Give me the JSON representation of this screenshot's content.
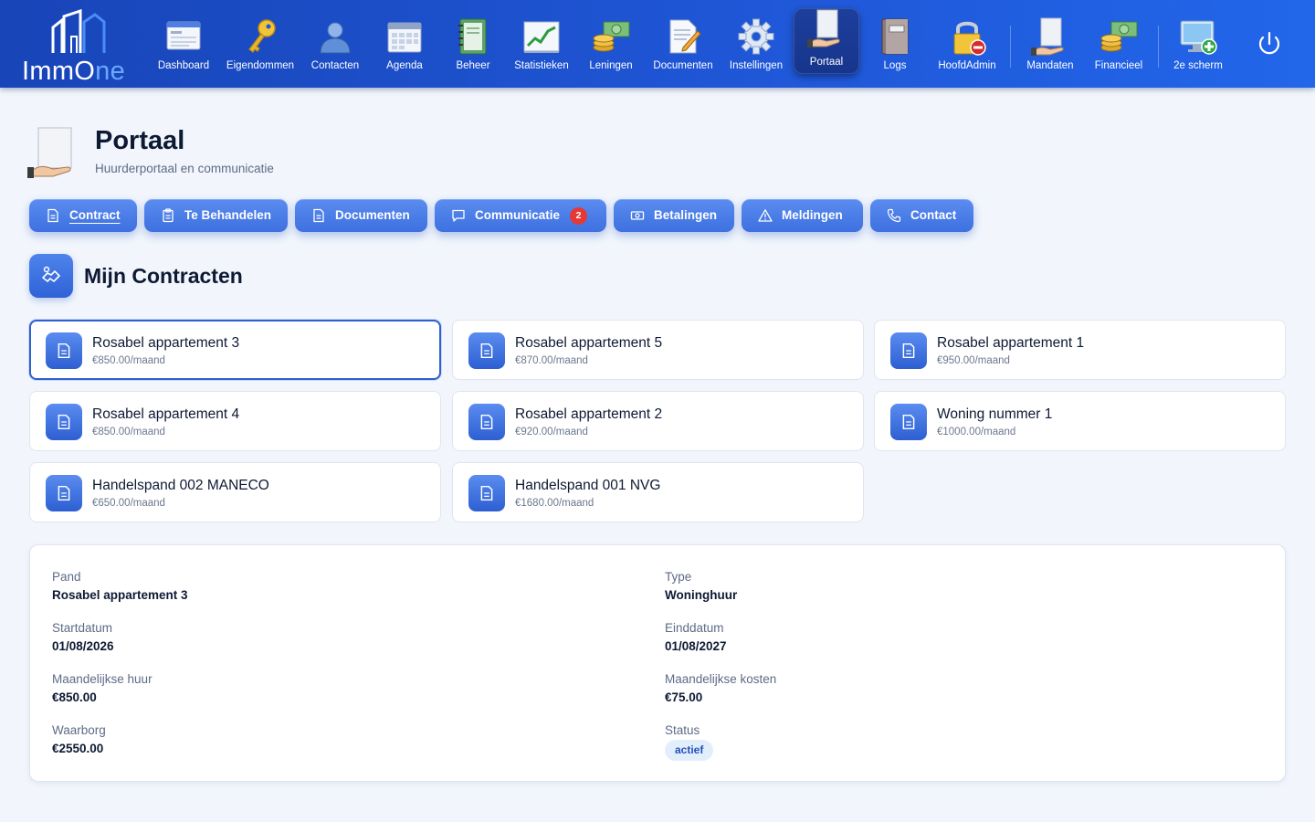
{
  "app": {
    "logo_main": "ImmO",
    "logo_accent": "ne"
  },
  "nav": [
    {
      "label": "Dashboard",
      "icon": "dashboard-window-icon"
    },
    {
      "label": "Eigendommen",
      "icon": "key-icon"
    },
    {
      "label": "Contacten",
      "icon": "person-icon"
    },
    {
      "label": "Agenda",
      "icon": "calendar-icon"
    },
    {
      "label": "Beheer",
      "icon": "notebook-icon"
    },
    {
      "label": "Statistieken",
      "icon": "chart-icon"
    },
    {
      "label": "Leningen",
      "icon": "money-coins-icon"
    },
    {
      "label": "Documenten",
      "icon": "document-pen-icon"
    },
    {
      "label": "Instellingen",
      "icon": "gear-icon"
    },
    {
      "label": "Portaal",
      "icon": "hand-document-icon",
      "active": true
    },
    {
      "label": "Logs",
      "icon": "logbook-icon"
    },
    {
      "label": "HoofdAdmin",
      "icon": "lock-icon"
    },
    {
      "label": "Mandaten",
      "icon": "hand-document-icon"
    },
    {
      "label": "Financieel",
      "icon": "money-coins-icon"
    },
    {
      "label": "2e scherm",
      "icon": "monitor-add-icon"
    }
  ],
  "page": {
    "title": "Portaal",
    "subtitle": "Huurderportaal en communicatie"
  },
  "tabs": [
    {
      "label": "Contract",
      "icon": "document-icon",
      "active": true
    },
    {
      "label": "Te Behandelen",
      "icon": "clipboard-icon"
    },
    {
      "label": "Documenten",
      "icon": "document-icon"
    },
    {
      "label": "Communicatie",
      "icon": "chat-icon",
      "badge": "2"
    },
    {
      "label": "Betalingen",
      "icon": "banknote-icon"
    },
    {
      "label": "Meldingen",
      "icon": "warning-icon"
    },
    {
      "label": "Contact",
      "icon": "phone-icon"
    }
  ],
  "section": {
    "title": "Mijn Contracten"
  },
  "contracts": [
    {
      "name": "Rosabel appartement 3",
      "price": "€850.00/maand",
      "selected": true
    },
    {
      "name": "Rosabel appartement 5",
      "price": "€870.00/maand"
    },
    {
      "name": "Rosabel appartement 1",
      "price": "€950.00/maand"
    },
    {
      "name": "Rosabel appartement 4",
      "price": "€850.00/maand"
    },
    {
      "name": "Rosabel appartement 2",
      "price": "€920.00/maand"
    },
    {
      "name": "Woning nummer 1",
      "price": "€1000.00/maand"
    },
    {
      "name": "Handelspand 002 MANECO",
      "price": "€650.00/maand"
    },
    {
      "name": "Handelspand 001 NVG",
      "price": "€1680.00/maand"
    }
  ],
  "details": {
    "pand_label": "Pand",
    "pand_value": "Rosabel appartement 3",
    "type_label": "Type",
    "type_value": "Woninghuur",
    "start_label": "Startdatum",
    "start_value": "01/08/2026",
    "end_label": "Einddatum",
    "end_value": "01/08/2027",
    "rent_label": "Maandelijkse huur",
    "rent_value": "€850.00",
    "costs_label": "Maandelijkse kosten",
    "costs_value": "€75.00",
    "deposit_label": "Waarborg",
    "deposit_value": "€2550.00",
    "status_label": "Status",
    "status_value": "actief"
  },
  "colors": {
    "nav_bg": "#1f56d6",
    "accent": "#3e70e0",
    "badge": "#e53935",
    "status_bg": "#e3eefc"
  }
}
